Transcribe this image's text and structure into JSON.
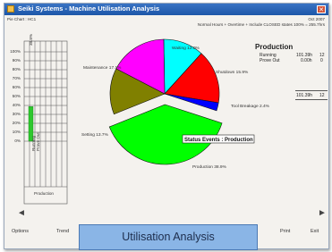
{
  "window": {
    "title": "Seiki Systems - Machine Utilisation Analysis",
    "close_glyph": "✕"
  },
  "header": {
    "chart_ref": "Pie Chart : HC1",
    "period": "Oct 2007",
    "hours_note": "Normal Hours + Overtime + Include CLOSED states 100% = 255.7hrs"
  },
  "bar_panel": {
    "top_label": "38.8%",
    "y_ticks": [
      "100%",
      "90%",
      "80%",
      "70%",
      "60%",
      "50%",
      "40%",
      "30%",
      "20%",
      "10%",
      "0%"
    ],
    "column_labels": [
      "Running",
      "Prove Out"
    ],
    "bottom_label": "Production",
    "fill_fraction": 0.388,
    "fill_color": "#2ec82e"
  },
  "chart_data": {
    "type": "pie",
    "slices": [
      {
        "label": "Waiting 12.0%",
        "value": 12.0,
        "color": "#00ffff"
      },
      {
        "label": "Shutdown 15.9%",
        "value": 15.9,
        "color": "#ff0000"
      },
      {
        "label": "Tool Breakage 2.4%",
        "value": 2.4,
        "color": "#0000ff"
      },
      {
        "label": "Production 38.9%",
        "value": 38.9,
        "color": "#00ff00"
      },
      {
        "label": "Setting 13.7%",
        "value": 13.7,
        "color": "#808000"
      },
      {
        "label": "Maintenance 17.1%",
        "value": 17.1,
        "color": "#ff00ff"
      }
    ],
    "exploded": "Production 38.9%",
    "tooltip": "Status Events : Production"
  },
  "summary": {
    "title": "Production",
    "rows": [
      {
        "label": "Running",
        "hours": "101.39h",
        "count": "12"
      },
      {
        "label": "Prove Out",
        "hours": "0.00h",
        "count": "0"
      }
    ],
    "total": {
      "hours": "101.39h",
      "count": "12"
    }
  },
  "toolbar": {
    "options": "Options",
    "trend": "Trend",
    "print": "Print",
    "exit": "Exit",
    "left_arrow": "◄",
    "right_arrow": "►"
  },
  "banner": {
    "text": "Utilisation Analysis"
  }
}
